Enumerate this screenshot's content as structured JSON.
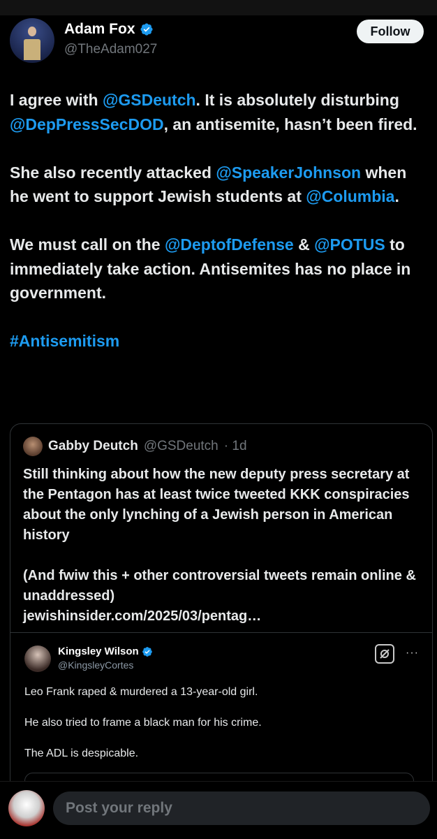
{
  "author": {
    "name": "Adam Fox",
    "handle": "@TheAdam027",
    "verified_color": "#1d9bf0"
  },
  "follow_label": "Follow",
  "post": {
    "p1": {
      "a": "I agree with ",
      "m1": "@GSDeutch",
      "b": ". It is absolutely disturbing ",
      "m2": "@DepPressSecDOD",
      "c": ", an antisemite, hasn’t been fired."
    },
    "p2": {
      "a": "She also recently attacked ",
      "m1": "@SpeakerJohnson",
      "b": " when he went to support Jewish students at ",
      "m2": "@Columbia",
      "c": "."
    },
    "p3": {
      "a": "We must call on the ",
      "m1": "@DeptofDefense",
      "b": " & ",
      "m2": "@POTUS",
      "c": " to immediately take action. Antisemites has no place in government."
    },
    "hashtag": "#Antisemitism"
  },
  "quote": {
    "name": "Gabby Deutch",
    "handle": "@GSDeutch",
    "time": "· 1d",
    "p1": "Still thinking about how the new deputy press secretary at the Pentagon has at least twice tweeted KKK conspiracies about the only lynching of a Jewish person in American history",
    "p2": "(And fwiw this + other controversial tweets remain online & unaddressed)",
    "link": "jewishinsider.com/2025/03/pentag…"
  },
  "embedded": {
    "name": "Kingsley Wilson",
    "handle": "@KingsleyCortes",
    "more": "···",
    "lines": [
      "Leo Frank raped & murdered a 13-year-old girl.",
      "He also tried to frame a black man for his crime.",
      "The ADL is despicable."
    ]
  },
  "reply": {
    "placeholder": "Post your reply"
  },
  "colors": {
    "background": "#000000",
    "link": "#1d9bf0",
    "muted": "#71767b",
    "border": "#2f3336"
  }
}
